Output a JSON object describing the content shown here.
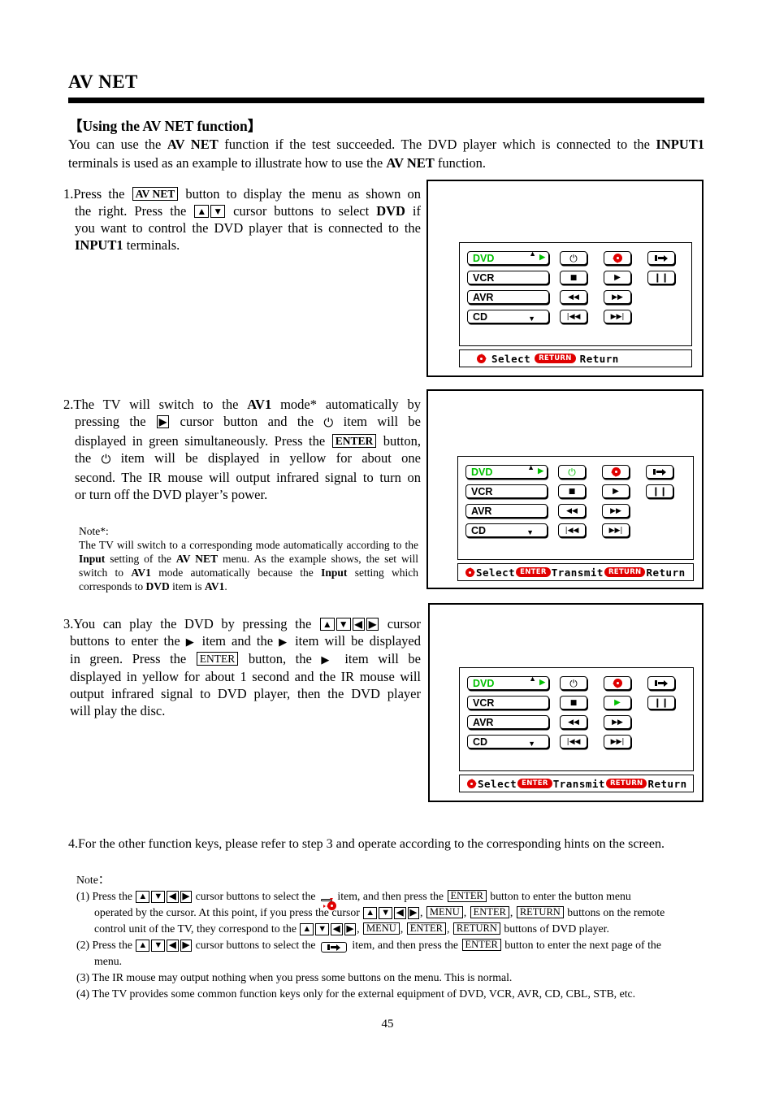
{
  "page": {
    "title": "AV NET",
    "number": "45"
  },
  "section": {
    "heading": "【Using the AV NET function】",
    "intro_line1_a": "You can use the ",
    "intro_line1_b": "AV NET",
    "intro_line1_c": " function if the test succeeded. The DVD player which is connected to the ",
    "intro_line1_d": "INPUT1",
    "intro_line2_a": "terminals is used as an example to illustrate how to use the ",
    "intro_line2_b": "AV NET",
    "intro_line2_c": " function."
  },
  "steps": {
    "step1": {
      "number": "1.",
      "t1": "Press the ",
      "key_avnet": "AV NET",
      "t2": " button to display the menu as shown on",
      "t3": "the right. Press the ",
      "key_up": "▲",
      "key_down": "▼",
      "t4": " cursor buttons to select ",
      "b_dvd": "DVD",
      "t5": " if",
      "t6": "you want to control the DVD player that is connected to the",
      "b_input1": "INPUT1",
      "t7": " terminals."
    },
    "step2": {
      "number": "2.",
      "t1": "The TV will switch to the ",
      "b_av1": "AV1",
      "t2": " mode* automatically by",
      "t3": "pressing the ",
      "key_right": "▶",
      "t4": " cursor button and the ",
      "glyph_power": "⏻",
      "t5": " item will be",
      "t6": "displayed in green simultaneously. Press the ",
      "key_enter": "ENTER",
      "t7": " button,",
      "t8": "the ",
      "t9": " item will be displayed in yellow for about one",
      "t10": "second. The IR mouse will output infrared signal to turn on",
      "t11": "or turn off the DVD player’s power."
    },
    "step3": {
      "number": "3.",
      "t1": "You can play the DVD by pressing the ",
      "key_up": "▲",
      "key_down": "▼",
      "key_left": "◀",
      "key_right": "▶",
      "t2": " cursor",
      "t3": "buttons to enter the ",
      "g1": "▶",
      "t4": " item and the ",
      "g2": "▶",
      "t5": " item will be displayed",
      "t6": "in green. Press the ",
      "key_enter": "ENTER",
      "t7": " button, the ",
      "g3": "▶",
      "t8": " item will be",
      "t9": "displayed in yellow for about 1 second and the IR mouse will",
      "t10": "output infrared signal to DVD player, then the DVD player",
      "t11": "will play the disc."
    },
    "step4": {
      "number": "4.",
      "text": "For the other function keys, please refer to step 3 and operate according to the corresponding hints on the screen."
    }
  },
  "note_star": {
    "header": "Note*:",
    "l1": "The TV will switch to a corresponding mode automatically according",
    "l2_a": "to the ",
    "l2_b": "Input",
    "l2_c": " setting of the ",
    "l2_d": "AV NET",
    "l2_e": " menu. As the example shows, the",
    "l3_a": "set will switch to ",
    "l3_b": "AV1",
    "l3_c": " mode automatically because the ",
    "l3_d": "Input",
    "l3_e": " setting",
    "l4_a": "which corresponds to ",
    "l4_b": "DVD",
    "l4_c": " item is ",
    "l4_d": "AV1",
    "l4_e": "."
  },
  "notes": {
    "header": "Note：",
    "n1_a": "(1) Press the ",
    "n1_keys": [
      "▲",
      "▼",
      "◀",
      "▶"
    ],
    "n1_b": " cursor buttons to select the ",
    "n1_icon": "dpad-icon",
    "n1_c": " item, and then press the ",
    "n1_enter": "ENTER",
    "n1_d": " button to enter the button menu",
    "n1_e": "operated by the cursor. At this point, if you press the cursor ",
    "n1_f": ", ",
    "n1_menu": "MENU",
    "n1_enter2": "ENTER",
    "n1_return": "RETURN",
    "n1_g": " buttons on the remote",
    "n1_h": "control unit of the TV, they correspond to the ",
    "n1_menu2": "MENU",
    "n1_enter3": "ENTER",
    "n1_return2": "RETURN",
    "n1_i": " buttons of DVD player.",
    "n2_a": "(2) Press the ",
    "n2_b": " cursor buttons to select the ",
    "n2_icon": "next-page-icon",
    "n2_c": " item, and then press the ",
    "n2_enter": "ENTER",
    "n2_d": " button to enter the next page of the",
    "n2_e": "menu.",
    "n3": "(3) The IR mouse may output nothing when you press some buttons on the menu. This is normal.",
    "n4": "(4) The TV provides some common function keys only for the external equipment of DVD, VCR, AVR, CD, CBL, STB, etc."
  },
  "osd": {
    "sources": [
      {
        "label": "DVD",
        "highlighted": true
      },
      {
        "label": "VCR",
        "highlighted": false
      },
      {
        "label": "AVR",
        "highlighted": false
      },
      {
        "label": "CD",
        "highlighted": false
      }
    ],
    "scroll_up": "▲",
    "scroll_right": "▶",
    "scroll_down": "▼",
    "buttons": {
      "power": "⏻",
      "dpad": "dpad-icon",
      "nextpage": "next-page-icon",
      "stop": "■",
      "play": "▶",
      "pause": "❙❙",
      "rewind": "◀◀",
      "fast_forward": "▶▶",
      "previous": "|◀◀",
      "next": "▶▶|"
    },
    "hint1": {
      "select": "Select",
      "return_key": "RETURN",
      "return_label": "Return"
    },
    "hint2": {
      "select": "Select",
      "enter_key": "ENTER",
      "transmit_label": "Transmit",
      "return_key": "RETURN",
      "return_label": "Return"
    }
  },
  "colors": {
    "highlight_green": "#00c000",
    "accent_red": "#e00000",
    "text_black": "#000000"
  }
}
